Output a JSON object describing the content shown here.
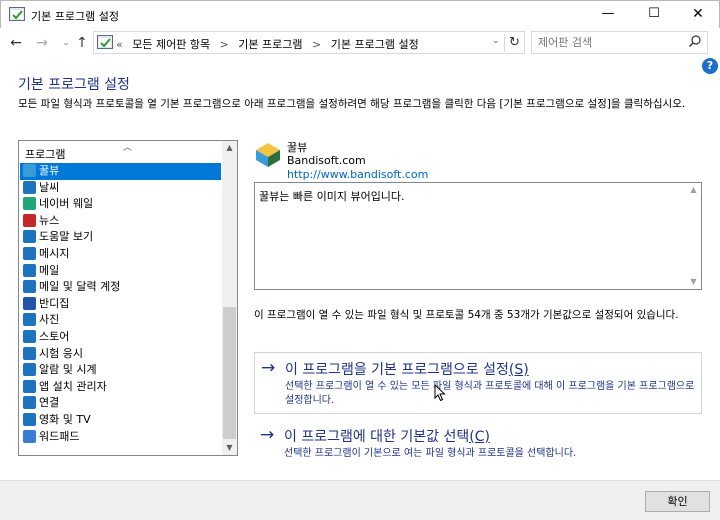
{
  "window": {
    "title": "기본 프로그램 설정"
  },
  "window_controls": {
    "minimize": "—",
    "maximize": "☐",
    "close": "✕"
  },
  "nav": {
    "back": "←",
    "forward": "→",
    "history": "⌄",
    "up": "↑"
  },
  "address": {
    "prefix": "«",
    "crumbs": [
      "모든 제어판 항목",
      "기본 프로그램",
      "기본 프로그램 설정"
    ],
    "separator": ">"
  },
  "search": {
    "placeholder": "제어판 검색"
  },
  "help": {
    "label": "?"
  },
  "page": {
    "title": "기본 프로그램 설정",
    "description": "모든 파일 형식과 프로토콜을 열 기본 프로그램으로 아래 프로그램을 설정하려면 해당 프로그램을 클릭한 다음 [기본 프로그램으로 설정]을 클릭하십시오."
  },
  "program_list": {
    "header": "프로그램",
    "selected_index": 0,
    "items": [
      {
        "label": "꿀뷰",
        "icon": "honeyview-icon",
        "color": "#3a9bd9"
      },
      {
        "label": "날씨",
        "icon": "weather-icon",
        "color": "#1e73be"
      },
      {
        "label": "네이버 웨일",
        "icon": "whale-icon",
        "color": "#1fa67a"
      },
      {
        "label": "뉴스",
        "icon": "news-icon",
        "color": "#c62828"
      },
      {
        "label": "도움말 보기",
        "icon": "help-view-icon",
        "color": "#1e73be"
      },
      {
        "label": "메시지",
        "icon": "messaging-icon",
        "color": "#1e73be"
      },
      {
        "label": "메일",
        "icon": "mail-icon",
        "color": "#1e73be"
      },
      {
        "label": "메일 및 달력 계정",
        "icon": "calendar-icon",
        "color": "#1e73be"
      },
      {
        "label": "반디집",
        "icon": "bandizip-icon",
        "color": "#2255aa"
      },
      {
        "label": "사진",
        "icon": "photos-icon",
        "color": "#1e73be"
      },
      {
        "label": "스토어",
        "icon": "store-icon",
        "color": "#1e73be"
      },
      {
        "label": "시험 응시",
        "icon": "take-a-test-icon",
        "color": "#1e73be"
      },
      {
        "label": "알람 및 시계",
        "icon": "alarm-icon",
        "color": "#1e73be"
      },
      {
        "label": "앱 설치 관리자",
        "icon": "app-installer-icon",
        "color": "#1e73be"
      },
      {
        "label": "연결",
        "icon": "connect-icon",
        "color": "#1e73be"
      },
      {
        "label": "영화 및 TV",
        "icon": "movies-icon",
        "color": "#1e73be"
      },
      {
        "label": "워드패드",
        "icon": "wordpad-icon",
        "color": "#3a7bd5"
      }
    ]
  },
  "selected_program": {
    "name": "꿀뷰",
    "company": "Bandisoft.com",
    "url": "http://www.bandisoft.com",
    "description": "꿀뷰는 빠른 이미지 뷰어입니다.",
    "status": "이 프로그램이 열 수 있는 파일 형식 및 프로토콜 54개 중 53개가 기본값으로 설정되어 있습니다."
  },
  "actions": {
    "set_default": {
      "title": "이 프로그램을 기본 프로그램으로 설정",
      "hotkey": "(S)",
      "subtitle": "선택한 프로그램이 열 수 있는 모든 파일 형식과 프로토콜에 대해 이 프로그램을 기본 프로그램으로 설정합니다."
    },
    "choose_defaults": {
      "title": "이 프로그램에 대한 기본값 선택",
      "hotkey": "(C)",
      "subtitle": "선택한 프로그램이 기본으로 여는 파일 형식과 프로토콜을 선택합니다."
    }
  },
  "footer": {
    "ok_label": "확인"
  }
}
